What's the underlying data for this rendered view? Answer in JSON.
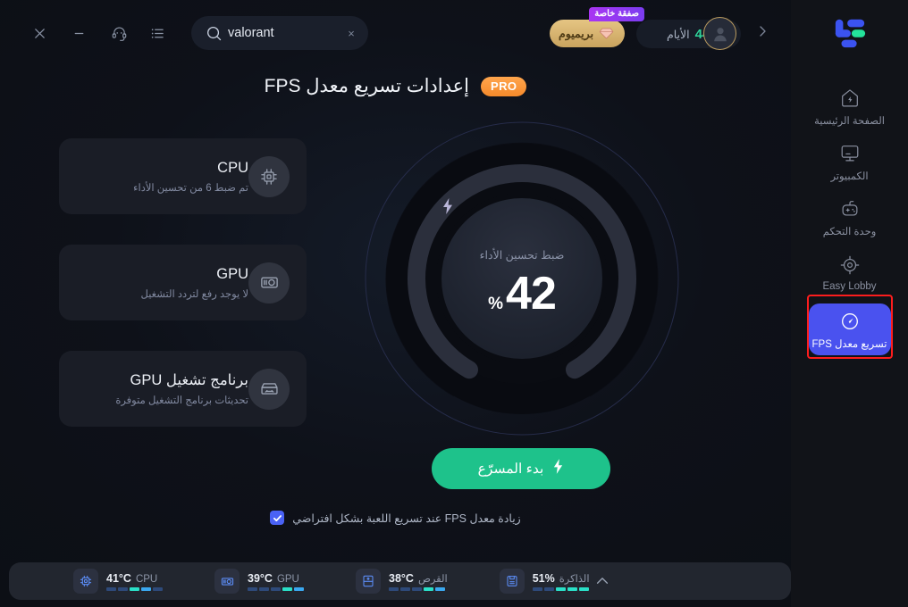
{
  "window": {
    "close_label": "close-window",
    "minimize_label": "minimize-window",
    "list_label": "list-menu",
    "support_label": "support"
  },
  "search": {
    "value": "valorant",
    "placeholder": "",
    "clear_label": "×"
  },
  "header": {
    "deal_badge": "صفقة خاصة",
    "premium_label": "بريميوم",
    "days_label": "الأيام",
    "days_count": "44",
    "next_label": "›"
  },
  "page": {
    "title": "إعدادات تسريع معدل FPS",
    "pro_badge": "PRO"
  },
  "cards": [
    {
      "id": "cpu",
      "title": "CPU",
      "subtitle": "تم ضبط 6 من تحسين الأداء",
      "icon": "cpu-chip-icon"
    },
    {
      "id": "gpu",
      "title": "GPU",
      "subtitle": "لا يوجد رفع لتردد التشغيل",
      "icon": "gpu-card-icon"
    },
    {
      "id": "gpu-driver",
      "title": "برنامج تشغيل GPU",
      "subtitle": "تحديثات برنامج التشغيل متوفرة",
      "icon": "driver-box-icon"
    }
  ],
  "gauge": {
    "label": "ضبط تحسين الأداء",
    "value": "42",
    "unit": "%",
    "percent": 42,
    "bolt_icon": "lightning-bolt-icon",
    "track_color": "#2b2f3c",
    "ring_color": "#2d3350"
  },
  "cta": {
    "label": "بدء المسرّع",
    "icon": "lightning-bolt-icon",
    "color": "#1ec28b"
  },
  "checkbox": {
    "checked": true,
    "label": "زيادة معدل FPS عند تسريع اللعبة بشكل افتراضي",
    "color": "#4a62f5"
  },
  "statusbar": {
    "stats": [
      {
        "name": "CPU",
        "value": "41°C",
        "icon": "cpu-chip-icon",
        "bars_on": 2,
        "bars_total": 5
      },
      {
        "name": "GPU",
        "value": "39°C",
        "icon": "gpu-card-icon",
        "bars_on": 2,
        "bars_total": 5
      },
      {
        "name": "القرص",
        "value": "38°C",
        "icon": "disk-icon",
        "bars_on": 2,
        "bars_total": 5
      },
      {
        "name": "الذاكرة",
        "value": "51%",
        "icon": "memory-icon",
        "bars_on": 3,
        "bars_total": 5
      }
    ],
    "collapse_icon": "chevron-up-icon"
  },
  "sidebar": {
    "logo": "app-logo",
    "items": [
      {
        "id": "home",
        "label": "الصفحة الرئيسية",
        "icon": "home-bolt-icon",
        "active": false
      },
      {
        "id": "computer",
        "label": "الكمبيوتر",
        "icon": "monitor-icon",
        "active": false
      },
      {
        "id": "console",
        "label": "وحدة التحكم",
        "icon": "gamepad-icon",
        "active": false
      },
      {
        "id": "easy-lobby",
        "label": "Easy Lobby",
        "icon": "crosshair-icon",
        "active": false
      },
      {
        "id": "fps-boost",
        "label": "تسريع معدل FPS",
        "icon": "speedometer-icon",
        "active": true
      }
    ],
    "active_color": "#4a52ef",
    "highlight_color": "#fc1d1d"
  }
}
